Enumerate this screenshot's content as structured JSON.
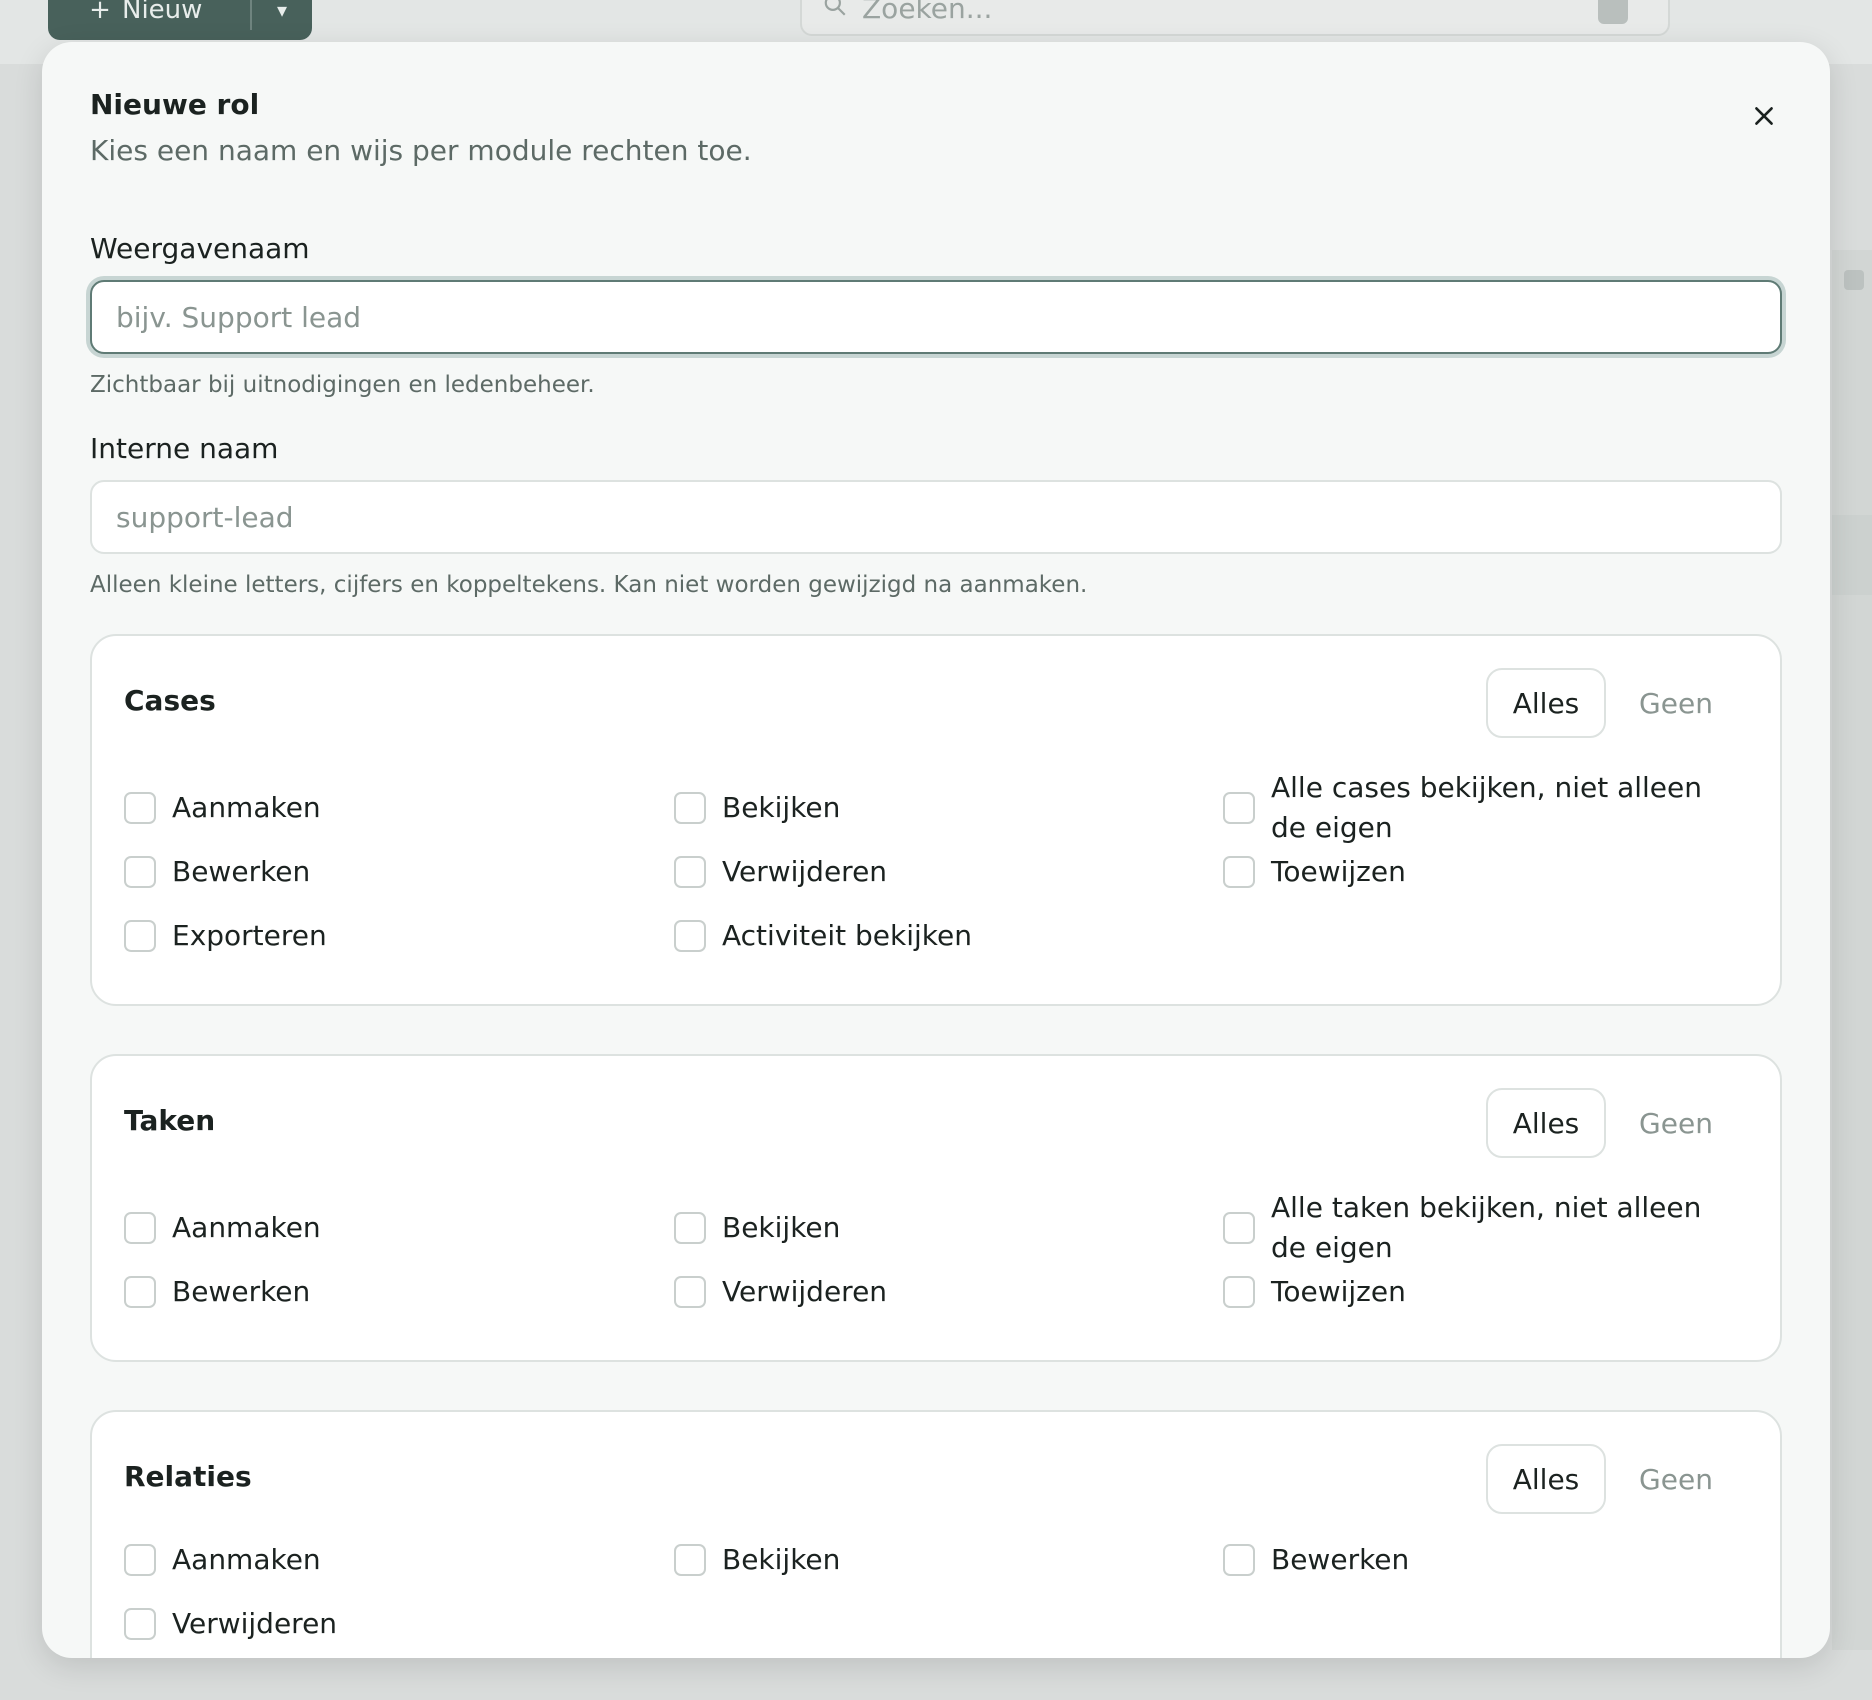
{
  "background": {
    "new_button_label": "Nieuw",
    "search_placeholder": "Zoeken..."
  },
  "modal": {
    "title": "Nieuwe rol",
    "subtitle": "Kies een naam en wijs per module rechten toe.",
    "close_icon": "close-icon",
    "display_name": {
      "label": "Weergavenaam",
      "placeholder": "bijv. Support lead",
      "value": "",
      "hint": "Zichtbaar bij uitnodigingen en ledenbeheer."
    },
    "internal_name": {
      "label": "Interne naam",
      "placeholder": "support-lead",
      "value": "",
      "hint": "Alleen kleine letters, cijfers en koppeltekens. Kan niet worden gewijzigd na aanmaken."
    },
    "modules": [
      {
        "title": "Cases",
        "all_label": "Alles",
        "none_label": "Geen",
        "permissions": [
          {
            "label": "Aanmaken",
            "checked": false
          },
          {
            "label": "Bekijken",
            "checked": false
          },
          {
            "label": "Alle cases bekijken, niet alleen de eigen",
            "checked": false
          },
          {
            "label": "Bewerken",
            "checked": false
          },
          {
            "label": "Verwijderen",
            "checked": false
          },
          {
            "label": "Toewijzen",
            "checked": false
          },
          {
            "label": "Exporteren",
            "checked": false
          },
          {
            "label": "Activiteit bekijken",
            "checked": false
          }
        ]
      },
      {
        "title": "Taken",
        "all_label": "Alles",
        "none_label": "Geen",
        "permissions": [
          {
            "label": "Aanmaken",
            "checked": false
          },
          {
            "label": "Bekijken",
            "checked": false
          },
          {
            "label": "Alle taken bekijken, niet alleen de eigen",
            "checked": false
          },
          {
            "label": "Bewerken",
            "checked": false
          },
          {
            "label": "Verwijderen",
            "checked": false
          },
          {
            "label": "Toewijzen",
            "checked": false
          }
        ]
      },
      {
        "title": "Relaties",
        "all_label": "Alles",
        "none_label": "Geen",
        "permissions": [
          {
            "label": "Aanmaken",
            "checked": false
          },
          {
            "label": "Bekijken",
            "checked": false
          },
          {
            "label": "Bewerken",
            "checked": false
          },
          {
            "label": "Verwijderen",
            "checked": false
          }
        ]
      }
    ]
  },
  "colors": {
    "accent": "#2d4a44",
    "focus_ring": "#5f7b75",
    "muted_text": "#5d6a66"
  }
}
